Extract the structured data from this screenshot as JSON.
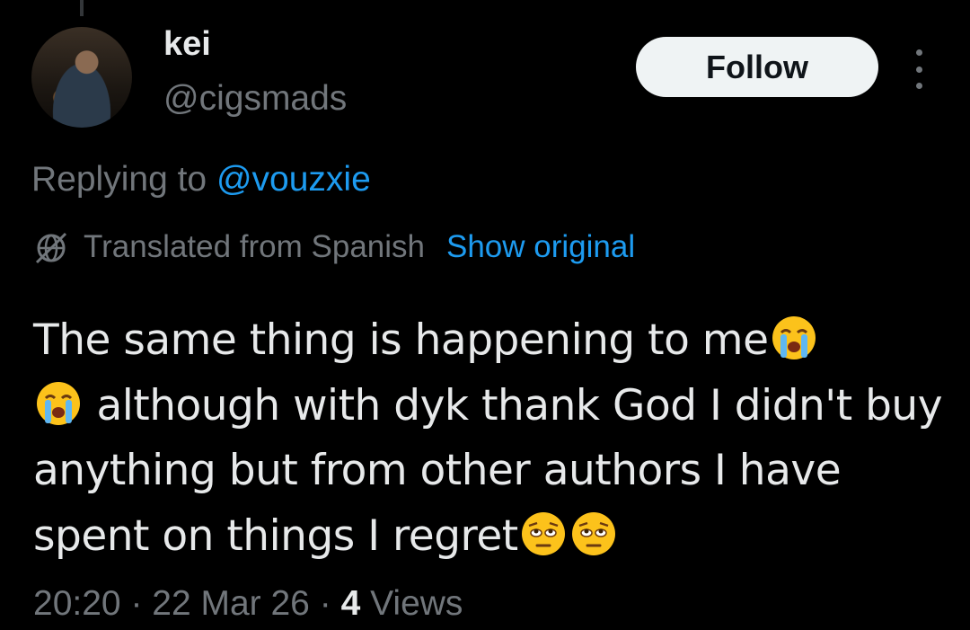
{
  "author": {
    "display_name": "kei",
    "handle": "@cigsmads",
    "avatar": "profile-photo"
  },
  "follow_button": {
    "label": "Follow"
  },
  "more_menu": {
    "icon": "more-vertical-icon"
  },
  "reply": {
    "prefix": "Replying to ",
    "mention": "@vouzxie"
  },
  "translation": {
    "icon": "translate-globe-icon",
    "label": "Translated from Spanish",
    "show_original": "Show original"
  },
  "tweet": {
    "part1": "The same thing is happening to me",
    "emoji_1": "loudly-crying-face",
    "emoji_2": "loudly-crying-face",
    "part2": " although with dyk thank God I didn't buy anything but from other authors I have spent on things I regret",
    "emoji_3": "pleading-face",
    "emoji_4": "pleading-face"
  },
  "meta": {
    "time": "20:20",
    "separator": " · ",
    "date": "22 Mar 26",
    "views_count": "4",
    "views_label": " Views"
  },
  "colors": {
    "background": "#000000",
    "text": "#e7e9ea",
    "muted": "#71767b",
    "link": "#1d9bf0",
    "follow_bg": "#eff3f4"
  }
}
